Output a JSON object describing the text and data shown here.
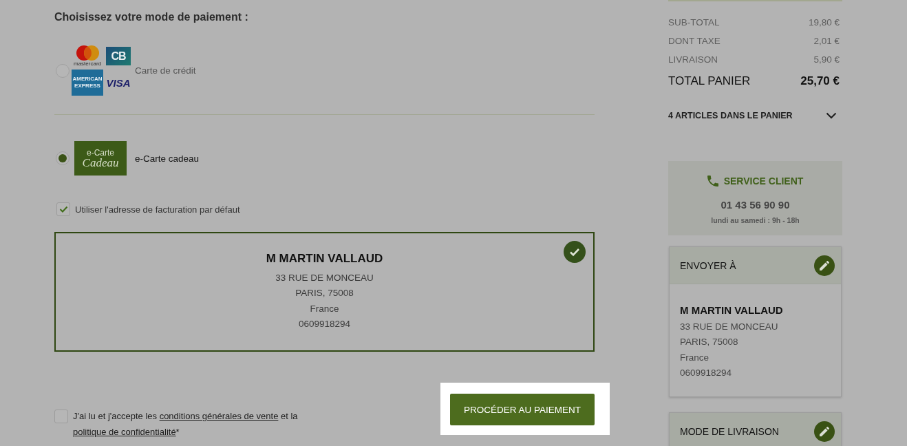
{
  "payment": {
    "title": "Choisissez votre mode de paiement :",
    "methods": [
      {
        "kind": "cards",
        "label": "Carte de crédit",
        "selected": false,
        "logos": [
          {
            "kind": "circles",
            "text": "mastercard"
          },
          {
            "kind": "tile-blue",
            "text": "AMERICAN EXPRESS"
          },
          {
            "kind": "tile",
            "text": "CB"
          },
          {
            "kind": "wordmark",
            "text": "VISA"
          }
        ]
      },
      {
        "kind": "gift",
        "label": "e-Carte cadeau",
        "selected": true,
        "logo_lines": [
          "e-Carte",
          "Cadeau"
        ]
      }
    ]
  },
  "billing_default": {
    "label": "Utiliser l'adresse de facturation par défaut",
    "checked": true
  },
  "billing_address": {
    "selected": true,
    "name": "M MARTIN VALLAUD",
    "lines": [
      "33 RUE DE MONCEAU",
      "PARIS, 75008",
      "France",
      "0609918294"
    ]
  },
  "terms": {
    "checked": false,
    "parts": [
      {
        "kind": "text",
        "text": "J'ai lu et j'accepte les "
      },
      {
        "kind": "link",
        "text": "conditions générales de vente"
      },
      {
        "kind": "text",
        "text": " et la "
      },
      {
        "kind": "link",
        "text": "politique de confidentialité"
      },
      {
        "kind": "text",
        "text": "*"
      }
    ]
  },
  "pay_button": {
    "label": "PROCÉDER AU PAIEMENT",
    "spotlight": true
  },
  "summary": {
    "rows": [
      {
        "label": "SUB-TOTAL",
        "value": "19,80 €"
      },
      {
        "label": "DONT TAXE",
        "value": "2,01 €"
      },
      {
        "label": "LIVRAISON",
        "value": "5,90 €"
      }
    ],
    "total": {
      "label": "TOTAL PANIER",
      "value": "25,70 €"
    }
  },
  "cart": {
    "label": "4 ARTICLES DANS LE PANIER",
    "expanded": false
  },
  "service_client": {
    "title": "SERVICE CLIENT",
    "phone": "01 43 56 90 90",
    "hours": "lundi au samedi : 9h - 18h"
  },
  "panels": [
    {
      "title": "ENVOYER À",
      "address": {
        "name": "M MARTIN VALLAUD",
        "lines": [
          "33 RUE DE MONCEAU",
          "PARIS, 75008",
          "France",
          "0609918294"
        ]
      }
    },
    {
      "title": "MODE DE LIVRAISON"
    }
  ]
}
